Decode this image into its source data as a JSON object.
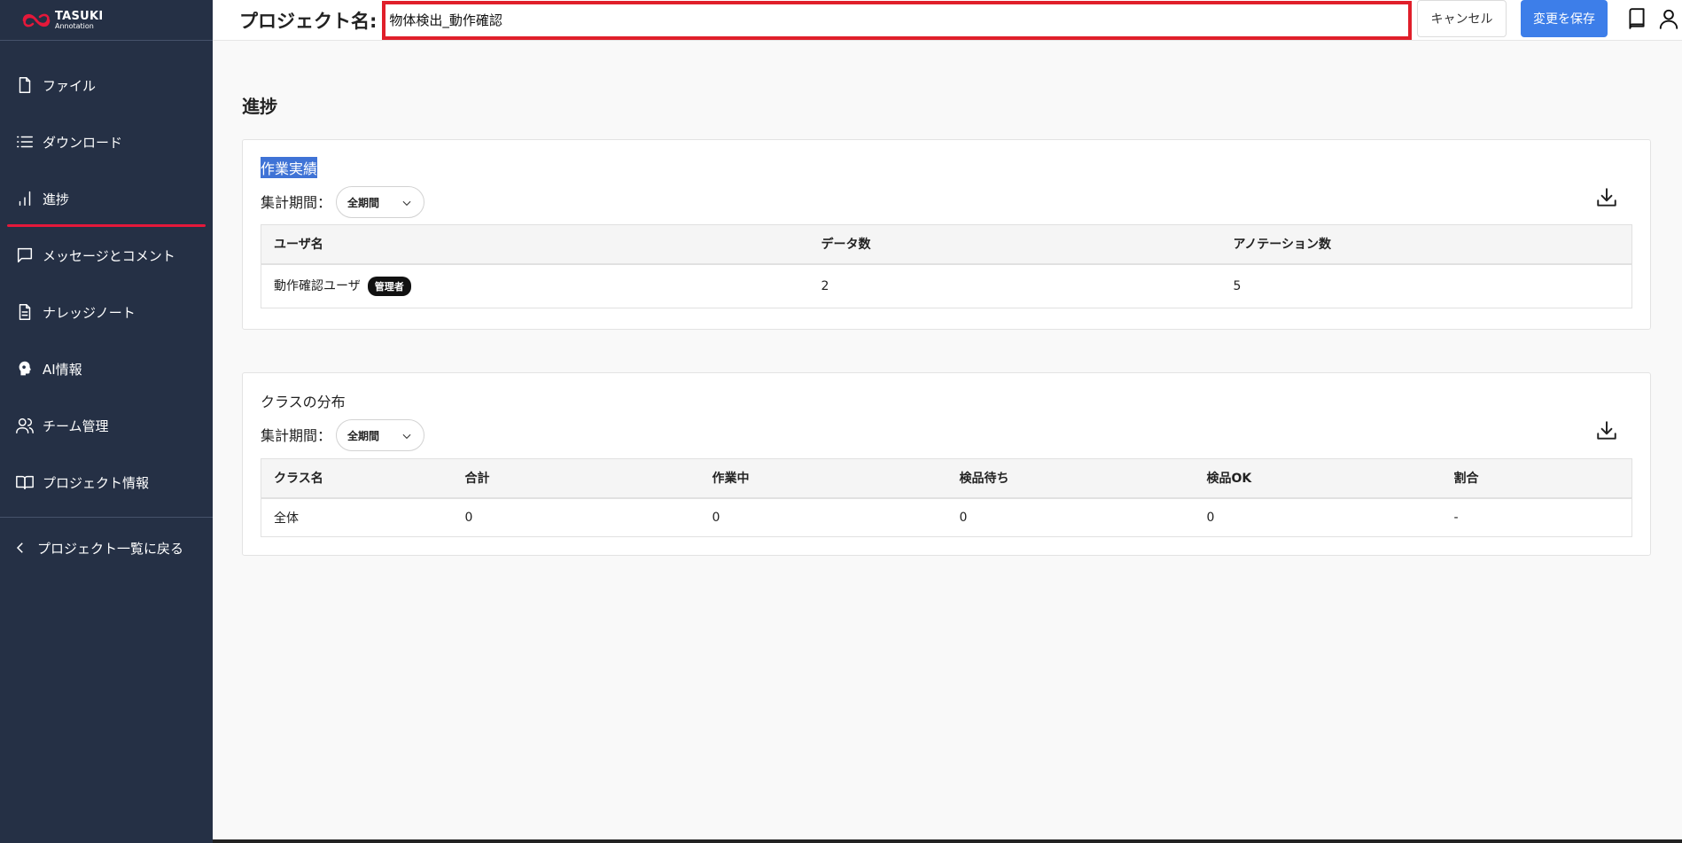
{
  "logo": {
    "line1": "TASUKI",
    "line2": "Annotation"
  },
  "sidebar": {
    "items": [
      {
        "label": "ファイル",
        "icon": "file-icon"
      },
      {
        "label": "ダウンロード",
        "icon": "list-icon"
      },
      {
        "label": "進捗",
        "icon": "bar-chart-icon",
        "active": true
      },
      {
        "label": "メッセージとコメント",
        "icon": "message-icon"
      },
      {
        "label": "ナレッジノート",
        "icon": "document-icon"
      },
      {
        "label": "AI情報",
        "icon": "ai-head-icon"
      },
      {
        "label": "チーム管理",
        "icon": "users-icon"
      },
      {
        "label": "プロジェクト情報",
        "icon": "book-open-icon"
      }
    ],
    "back_label": "プロジェクト一覧に戻る"
  },
  "header": {
    "project_label": "プロジェクト名:",
    "project_name": "物体検出_動作確認",
    "cancel_label": "キャンセル",
    "save_label": "変更を保存"
  },
  "main": {
    "title": "進捗",
    "performance": {
      "title": "作業実績",
      "period_label": "集計期間：",
      "period_value": "全期間",
      "columns": [
        "ユーザ名",
        "データ数",
        "アノテーション数"
      ],
      "rows": [
        {
          "user": "動作確認ユーザ",
          "badge": "管理者",
          "data_count": "2",
          "annotation_count": "5"
        }
      ]
    },
    "class_distribution": {
      "title": "クラスの分布",
      "period_label": "集計期間：",
      "period_value": "全期間",
      "columns": [
        "クラス名",
        "合計",
        "作業中",
        "検品待ち",
        "検品OK",
        "割合"
      ],
      "rows": [
        {
          "class_name": "全体",
          "total": "0",
          "in_progress": "0",
          "awaiting_inspection": "0",
          "inspection_ok": "0",
          "ratio": "-"
        }
      ]
    }
  },
  "colors": {
    "sidebar_bg": "#253045",
    "active_indicator": "#e5183a",
    "save_button": "#3d7ee9",
    "input_border": "#e01f2a",
    "logo_red": "#e5183a"
  }
}
